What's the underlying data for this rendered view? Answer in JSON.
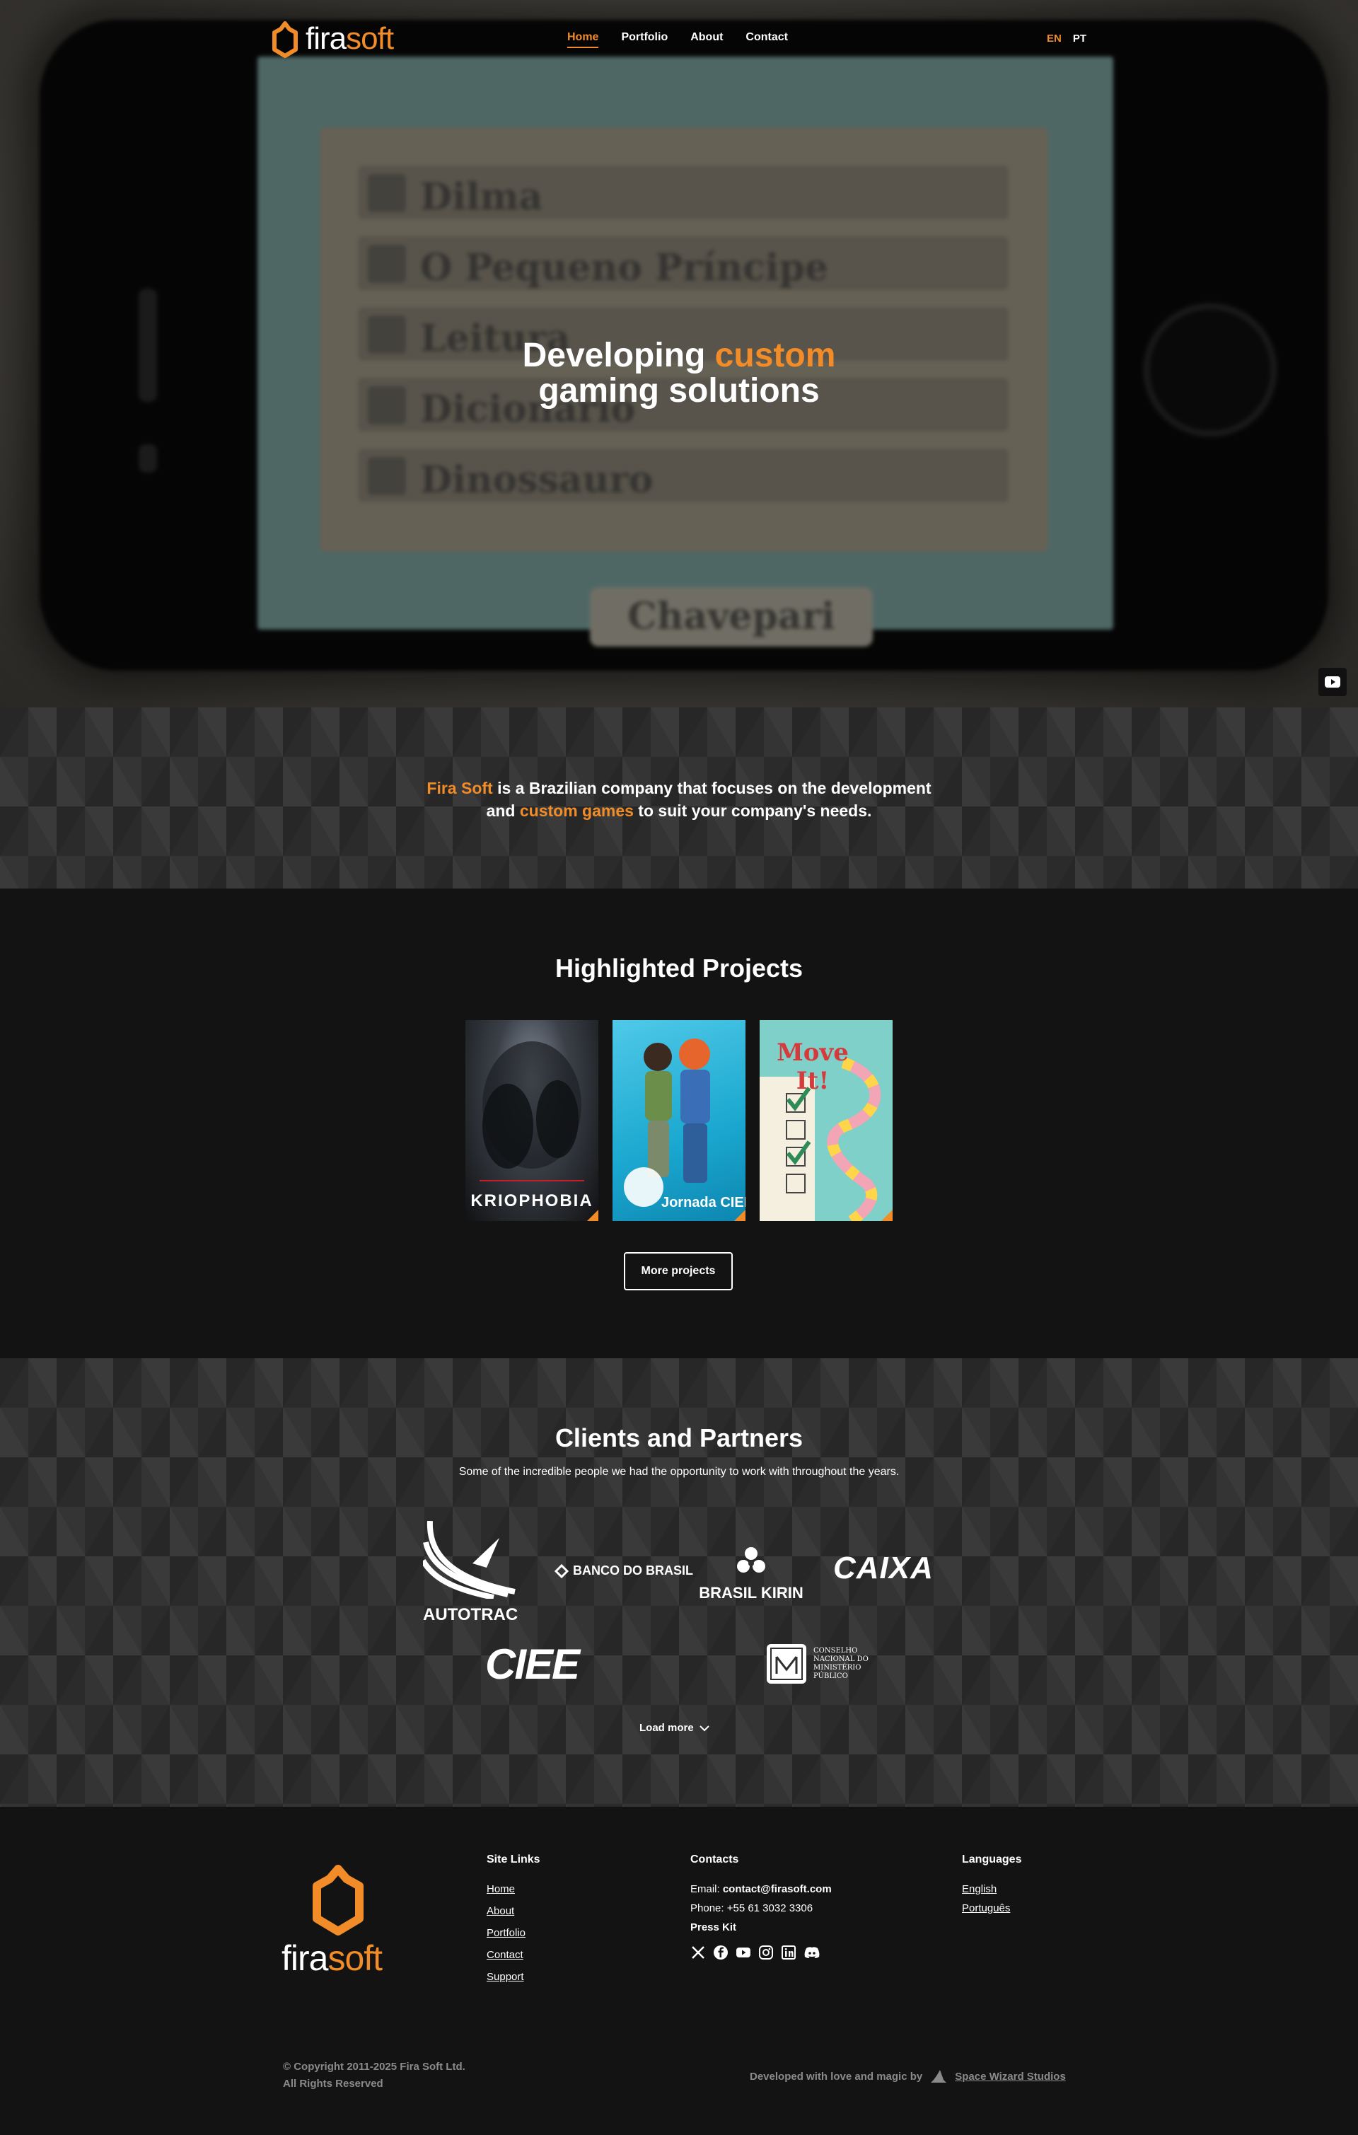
{
  "brand": {
    "name_part1": "fira",
    "name_part2": "soft",
    "accent": "#f28c28"
  },
  "nav": {
    "links": [
      "Home",
      "Portfolio",
      "About",
      "Contact"
    ],
    "active": "Home",
    "languages": [
      "EN",
      "PT"
    ],
    "active_language": "EN"
  },
  "hero": {
    "title_part1": "Developing ",
    "title_accent": "custom",
    "title_line2": "gaming solutions",
    "background_words": [
      "Dilma",
      "O Pequeno Príncipe",
      "Leitura",
      "Dicionário",
      "Dinossauro",
      "Chavepari"
    ]
  },
  "about": {
    "brand": "Fira Soft",
    "text1": " is a Brazilian company that focuses on the development",
    "text2_pre": "and ",
    "text2_accent": "custom games",
    "text2_post": " to suit your company's needs."
  },
  "projects": {
    "title": "Highlighted Projects",
    "cards": [
      "KRIOPHOBIA",
      "Jornada CIEE",
      "Move It!"
    ],
    "more_label": "More projects"
  },
  "clients": {
    "title": "Clients and Partners",
    "subtitle": "Some of the incredible people we had the opportunity to work with throughout the years.",
    "logos": [
      "AUTOTRAC",
      "BANCO DO BRASIL",
      "BRASIL KIRIN",
      "CAIXA",
      "CIEE",
      "CONSELHO NACIONAL DO MINISTÉRIO PÚBLICO"
    ],
    "load_more": "Load more"
  },
  "footer": {
    "site_links_title": "Site Links",
    "site_links": [
      "Home",
      "About",
      "Portfolio",
      "Contact",
      "Support"
    ],
    "contacts_title": "Contacts",
    "email_label": "Email: ",
    "email": "contact@firasoft.com",
    "phone_label": "Phone: ",
    "phone": "+55 61 3032 3306",
    "press_kit": "Press Kit",
    "social_icons": [
      "x-icon",
      "facebook-icon",
      "youtube-icon",
      "instagram-icon",
      "linkedin-icon",
      "discord-icon"
    ],
    "languages_title": "Languages",
    "languages": [
      "English",
      "Português"
    ],
    "copyright_line1": "© Copyright 2011-2025 Fira Soft Ltd.",
    "copyright_line2": "All Rights Reserved",
    "credit_text": "Developed with love and magic by",
    "credit_studio": "Space Wizard Studios"
  }
}
